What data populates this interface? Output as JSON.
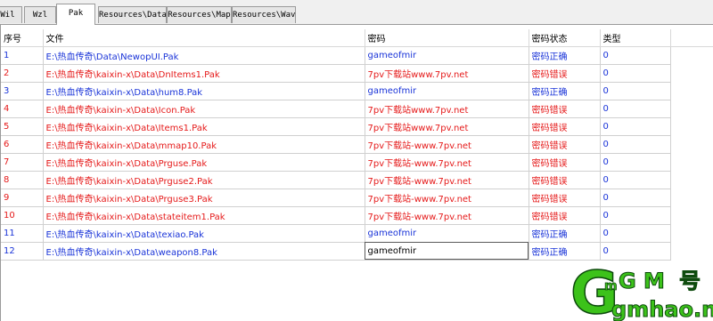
{
  "tabs": [
    {
      "label": "Wil",
      "active": false
    },
    {
      "label": "Wzl",
      "active": false
    },
    {
      "label": "Pak",
      "active": true
    },
    {
      "label": "Resources\\Data",
      "active": false
    },
    {
      "label": "Resources\\Map",
      "active": false
    },
    {
      "label": "Resources\\Wav",
      "active": false
    }
  ],
  "table": {
    "columns": [
      "序号",
      "文件",
      "密码",
      "密码状态",
      "类型"
    ],
    "rows": [
      {
        "no": "1",
        "file": "E:\\热血传奇\\Data\\NewopUI.Pak",
        "password": "gameofmir",
        "status": "密码正确",
        "type": "0",
        "color": "blue"
      },
      {
        "no": "2",
        "file": "E:\\热血传奇\\kaixin-x\\Data\\DnItems1.Pak",
        "password": "7pv下载站www.7pv.net",
        "status": "密码错误",
        "type": "0",
        "color": "red"
      },
      {
        "no": "3",
        "file": "E:\\热血传奇\\kaixin-x\\Data\\hum8.Pak",
        "password": "gameofmir",
        "status": "密码正确",
        "type": "0",
        "color": "blue"
      },
      {
        "no": "4",
        "file": "E:\\热血传奇\\kaixin-x\\Data\\Icon.Pak",
        "password": "7pv下载站www.7pv.net",
        "status": "密码错误",
        "type": "0",
        "color": "red"
      },
      {
        "no": "5",
        "file": "E:\\热血传奇\\kaixin-x\\Data\\Items1.Pak",
        "password": "7pv下载站www.7pv.net",
        "status": "密码错误",
        "type": "0",
        "color": "red"
      },
      {
        "no": "6",
        "file": "E:\\热血传奇\\kaixin-x\\Data\\mmap10.Pak",
        "password": "7pv下载站-www.7pv.net",
        "status": "密码错误",
        "type": "0",
        "color": "red"
      },
      {
        "no": "7",
        "file": "E:\\热血传奇\\kaixin-x\\Data\\Prguse.Pak",
        "password": "7pv下载站-www.7pv.net",
        "status": "密码错误",
        "type": "0",
        "color": "red"
      },
      {
        "no": "8",
        "file": "E:\\热血传奇\\kaixin-x\\Data\\Prguse2.Pak",
        "password": "7pv下载站-www.7pv.net",
        "status": "密码错误",
        "type": "0",
        "color": "red"
      },
      {
        "no": "9",
        "file": "E:\\热血传奇\\kaixin-x\\Data\\Prguse3.Pak",
        "password": "7pv下载站-www.7pv.net",
        "status": "密码错误",
        "type": "0",
        "color": "red"
      },
      {
        "no": "10",
        "file": "E:\\热血传奇\\kaixin-x\\Data\\stateitem1.Pak",
        "password": "7pv下载站-www.7pv.net",
        "status": "密码错误",
        "type": "0",
        "color": "red"
      },
      {
        "no": "11",
        "file": "E:\\热血传奇\\kaixin-x\\Data\\texiao.Pak",
        "password": "gameofmir",
        "status": "密码正确",
        "type": "0",
        "color": "blue"
      },
      {
        "no": "12",
        "file": "E:\\热血传奇\\kaixin-x\\Data\\weapon8.Pak",
        "password": "gameofmir",
        "status": "密码正确",
        "type": "0",
        "color": "blue",
        "editing": true
      }
    ]
  },
  "watermark": {
    "big_letter": "G",
    "small_m": "m",
    "text_gm": "G M",
    "text_hao": "号",
    "url": "gmhao.net"
  },
  "colors": {
    "ok": "#1a34d8",
    "error": "#e51a1a",
    "watermark_green": "#3cc21a",
    "watermark_outline": "#0d4a0d"
  }
}
